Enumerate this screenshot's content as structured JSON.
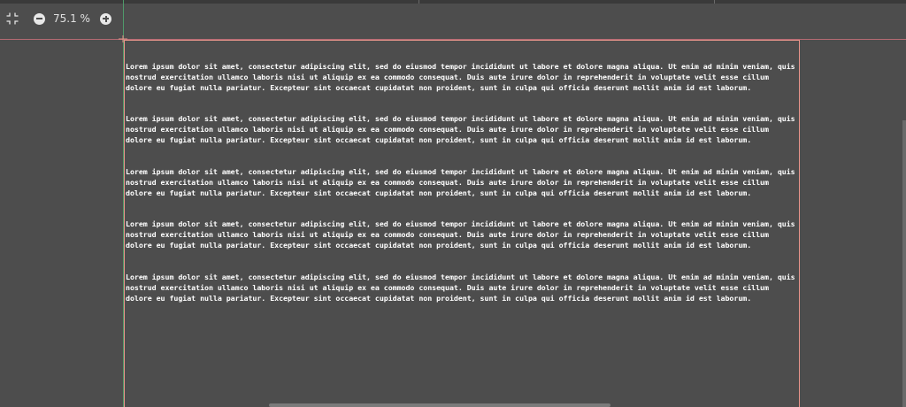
{
  "toolbar": {
    "fit_icon": "fit-to-view-icon",
    "zoom_out_icon": "zoom-out-icon",
    "zoom_level": "75.1 %",
    "zoom_in_icon": "zoom-in-icon"
  },
  "document": {
    "paragraphs": [
      "Lorem ipsum dolor sit amet, consectetur adipiscing elit, sed do eiusmod tempor incididunt ut labore et dolore magna aliqua. Ut enim ad minim veniam, quis nostrud exercitation ullamco laboris nisi ut aliquip ex ea commodo consequat. Duis aute irure dolor in reprehenderit in voluptate velit esse cillum dolore eu fugiat nulla pariatur. Excepteur sint occaecat cupidatat non proident, sunt in culpa qui officia deserunt mollit anim id est laborum.",
      "Lorem ipsum dolor sit amet, consectetur adipiscing elit, sed do eiusmod tempor incididunt ut labore et dolore magna aliqua. Ut enim ad minim veniam, quis nostrud exercitation ullamco laboris nisi ut aliquip ex ea commodo consequat. Duis aute irure dolor in reprehenderit in voluptate velit esse cillum dolore eu fugiat nulla pariatur. Excepteur sint occaecat cupidatat non proident, sunt in culpa qui officia deserunt mollit anim id est laborum.",
      "Lorem ipsum dolor sit amet, consectetur adipiscing elit, sed do eiusmod tempor incididunt ut labore et dolore magna aliqua. Ut enim ad minim veniam, quis nostrud exercitation ullamco laboris nisi ut aliquip ex ea commodo consequat. Duis aute irure dolor in reprehenderit in voluptate velit esse cillum dolore eu fugiat nulla pariatur. Excepteur sint occaecat cupidatat non proident, sunt in culpa qui officia deserunt mollit anim id est laborum.",
      "Lorem ipsum dolor sit amet, consectetur adipiscing elit, sed do eiusmod tempor incididunt ut labore et dolore magna aliqua. Ut enim ad minim veniam, quis nostrud exercitation ullamco laboris nisi ut aliquip ex ea commodo consequat. Duis aute irure dolor in reprehenderit in voluptate velit esse cillum dolore eu fugiat nulla pariatur. Excepteur sint occaecat cupidatat non proident, sunt in culpa qui officia deserunt mollit anim id est laborum.",
      "Lorem ipsum dolor sit amet, consectetur adipiscing elit, sed do eiusmod tempor incididunt ut labore et dolore magna aliqua. Ut enim ad minim veniam, quis nostrud exercitation ullamco laboris nisi ut aliquip ex ea commodo consequat. Duis aute irure dolor in reprehenderit in voluptate velit esse cillum dolore eu fugiat nulla pariatur. Excepteur sint occaecat cupidatat non proident, sunt in culpa qui officia deserunt mollit anim id est laborum."
    ]
  },
  "colors": {
    "background": "#4d4d4d",
    "text": "#ffffff",
    "page_border": "#e8948a",
    "horizontal_guide": "#b56a73",
    "vertical_guide": "#4f9a6a"
  }
}
